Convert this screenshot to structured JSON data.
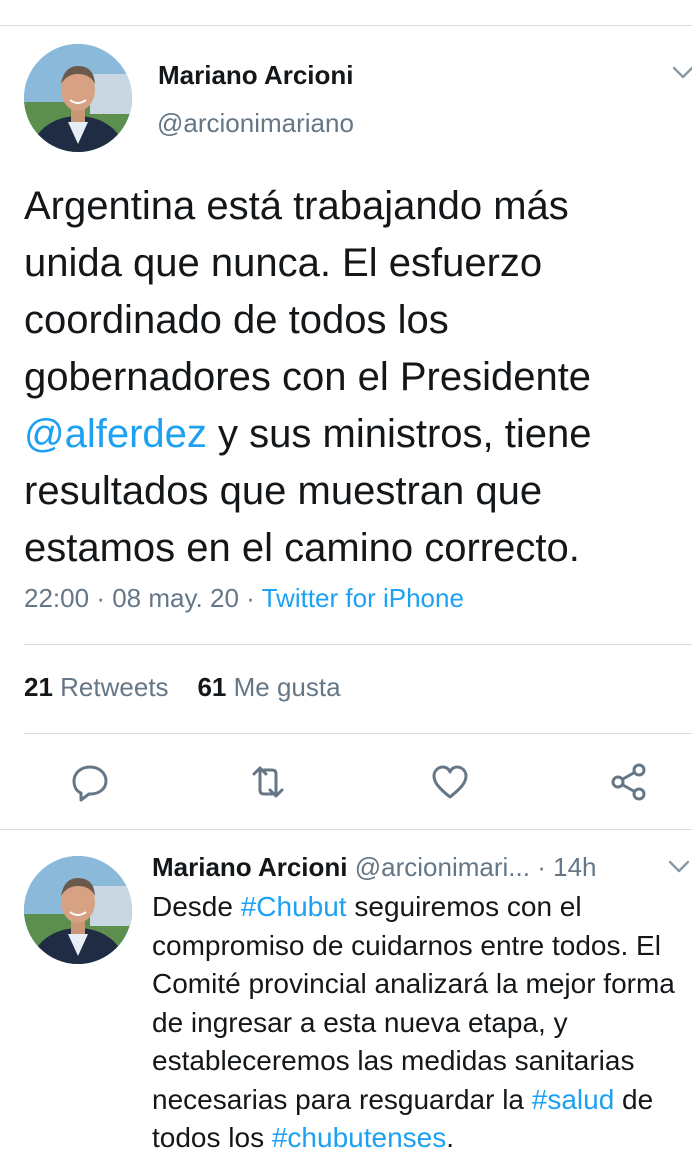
{
  "main_tweet": {
    "author_name": "Mariano Arcioni",
    "author_handle": "@arcionimariano",
    "text_before": "Argentina está trabajando más unida que nunca. El esfuerzo coordinado de todos los gobernadores con el Presidente ",
    "mention": "@alferdez",
    "text_after": " y sus ministros, tiene resultados que muestran que estamos en el camino correcto.",
    "time": "22:00",
    "date": "08 may. 20",
    "separator": "·",
    "source": "Twitter for iPhone",
    "retweets_count": "21",
    "retweets_label": "Retweets",
    "likes_count": "61",
    "likes_label": "Me gusta"
  },
  "actions": [
    "reply-icon",
    "retweet-icon",
    "like-icon",
    "share-icon"
  ],
  "second_tweet": {
    "author_name": "Mariano Arcioni",
    "author_handle": "@arcionimari...",
    "separator": "·",
    "time_ago": "14h",
    "t1": "Desde ",
    "hashtag1": "#Chubut",
    "t2": " seguiremos con el compromiso de cuidarnos entre todos. El Comité provincial analizará la mejor forma de ingresar a esta nueva etapa, y estableceremos las medidas sanitarias necesarias para resguardar la ",
    "hashtag2": "#salud",
    "t3": " de todos los ",
    "hashtag3": "#chubutenses",
    "t4": "."
  },
  "colors": {
    "link": "#1da1f2",
    "secondary_text": "#657786",
    "divider": "#d9dde1",
    "icon": "#657786"
  }
}
